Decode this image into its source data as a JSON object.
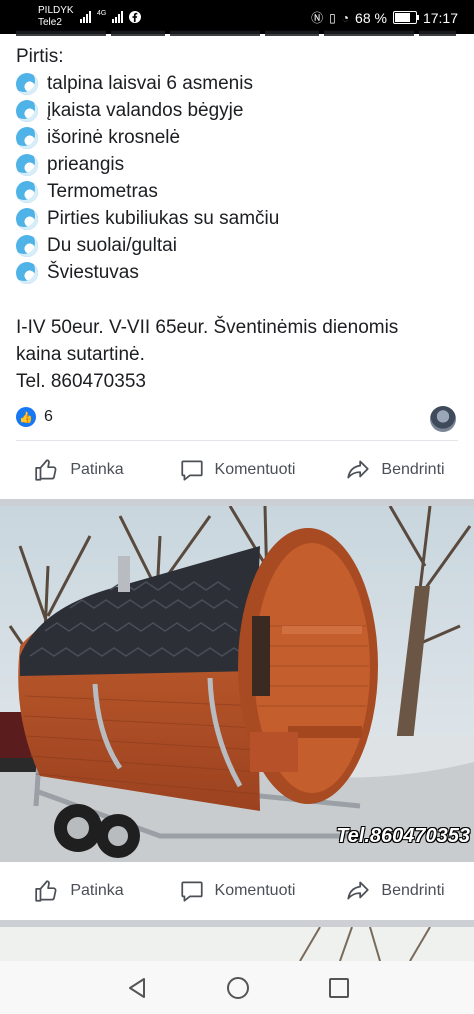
{
  "status_bar": {
    "carrier_line1": "PILDYK",
    "carrier_line2": "Tele2",
    "network": "4G",
    "battery_percent": "68 %",
    "time": "17:17"
  },
  "post": {
    "heading": "Pirtis:",
    "features": [
      "talpina laisvai 6 asmenis",
      "įkaista valandos bėgyje",
      "išorinė krosnelė",
      "prieangis",
      "Termometras",
      "Pirties kubiliukas su samčiu",
      "Du suolai/gultai",
      "Šviestuvas"
    ],
    "price_line1": "I-IV 50eur. V-VII 65eur. Šventinėmis dienomis",
    "price_line2": "kaina sutartinė.",
    "phone_line": "Tel. 860470353",
    "reaction_count": "6"
  },
  "actions": {
    "like": "Patinka",
    "comment": "Komentuoti",
    "share": "Bendrinti"
  },
  "photo": {
    "watermark": "Tel.860470353"
  },
  "colors": {
    "accent": "#1877f2",
    "wood": "#b9542a",
    "roof": "#2c2f36"
  }
}
